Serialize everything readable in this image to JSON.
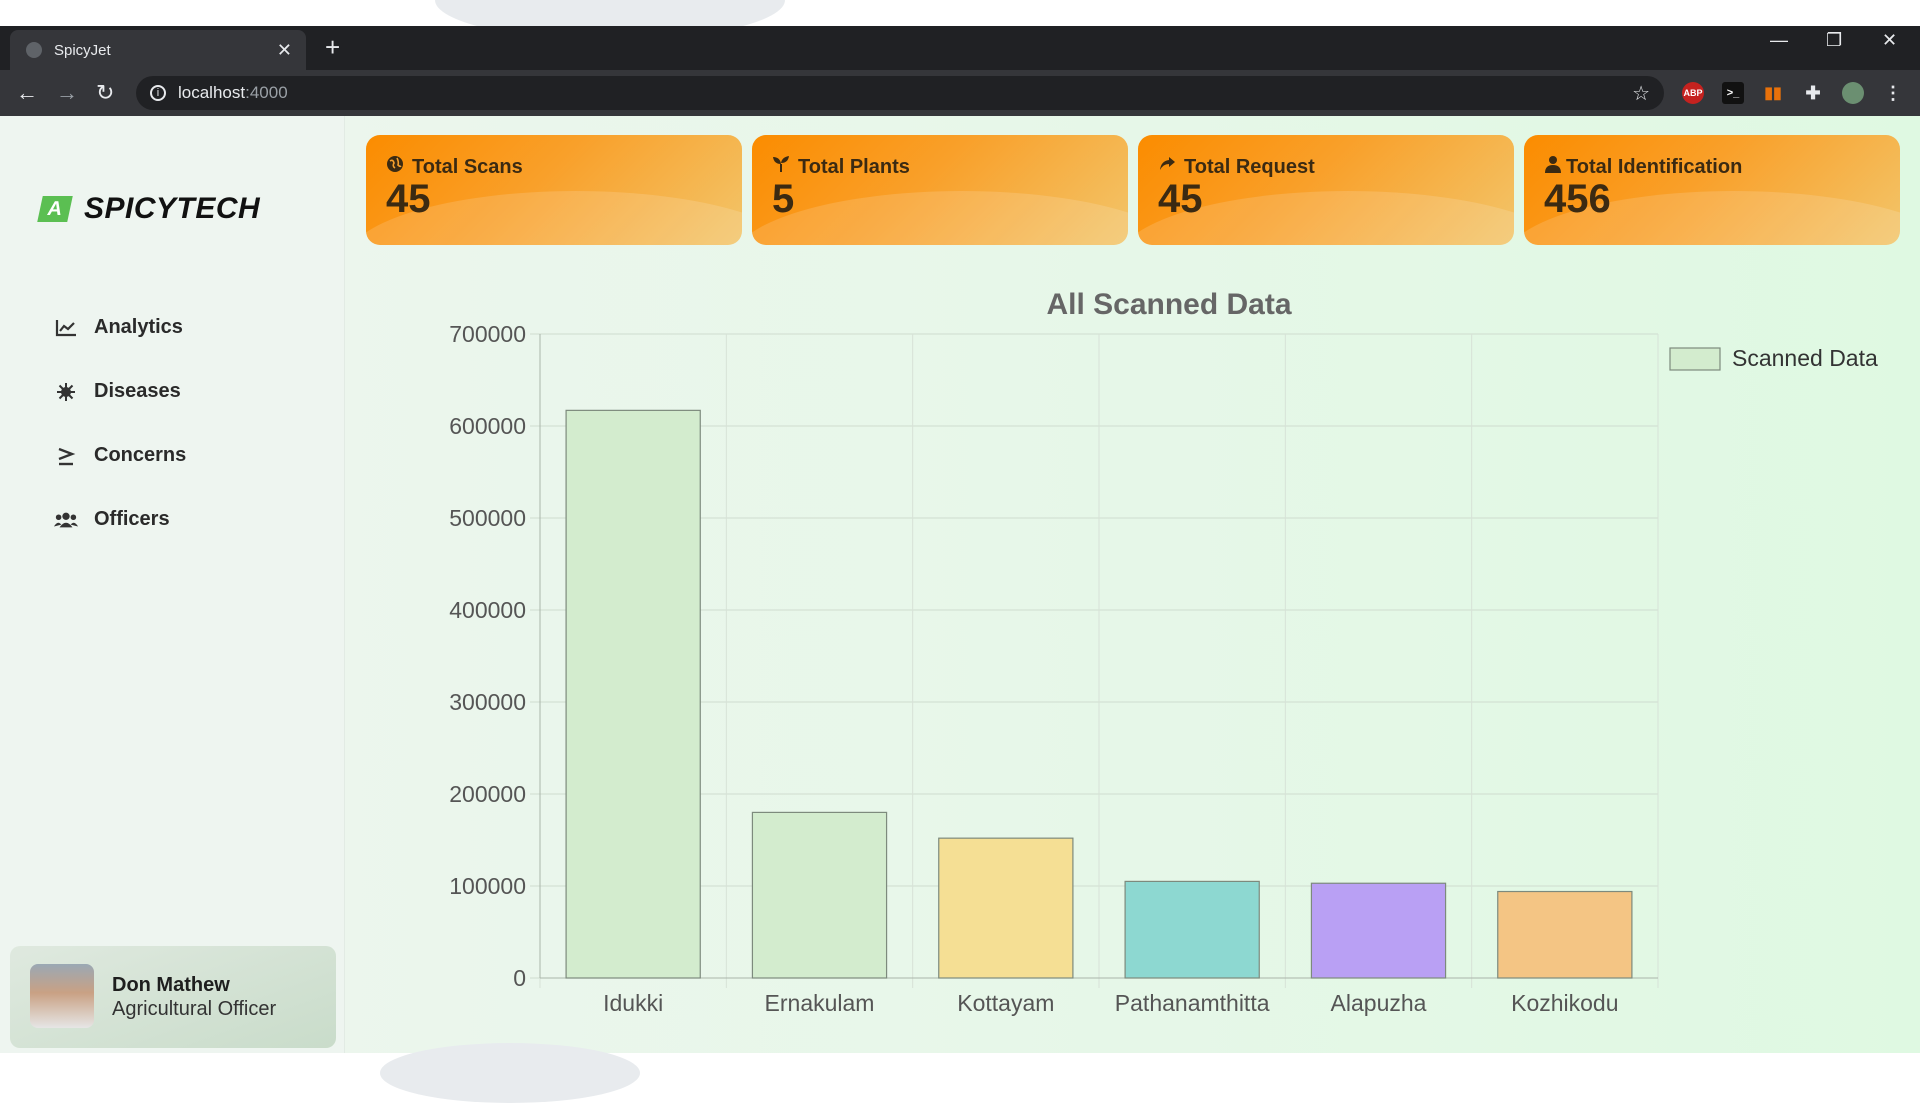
{
  "browser": {
    "tab_title": "SpicyJet",
    "url_host": "localhost",
    "url_port": ":4000"
  },
  "brand": {
    "logo_text": "SPICYTECH",
    "logo_mark": "A"
  },
  "sidebar": {
    "items": [
      {
        "label": "Analytics",
        "icon": "chart-line-icon"
      },
      {
        "label": "Diseases",
        "icon": "virus-icon"
      },
      {
        "label": "Concerns",
        "icon": "greater-equal-icon"
      },
      {
        "label": "Officers",
        "icon": "users-icon"
      }
    ]
  },
  "profile": {
    "name": "Don Mathew",
    "role": "Agricultural Officer"
  },
  "stats": [
    {
      "label": "Total Scans",
      "value": "45",
      "icon": "globe-icon"
    },
    {
      "label": "Total Plants",
      "value": "5",
      "icon": "seedling-icon"
    },
    {
      "label": "Total Request",
      "value": "45",
      "icon": "share-icon"
    },
    {
      "label": "Total Identification",
      "value": "456",
      "icon": "user-icon"
    }
  ],
  "chart_data": {
    "type": "bar",
    "title": "All Scanned Data",
    "categories": [
      "Idukki",
      "Ernakulam",
      "Kottayam",
      "Pathanamthitta",
      "Alapuzha",
      "Kozhikodu"
    ],
    "series": [
      {
        "name": "Scanned Data",
        "values": [
          617000,
          180000,
          152000,
          105000,
          103000,
          94000
        ]
      }
    ],
    "bar_colors": [
      "#d3ecce",
      "#d3ecce",
      "#f5df94",
      "#8dd8d1",
      "#b9a0f4",
      "#f4c584"
    ],
    "ylim": [
      0,
      700000
    ],
    "yticks": [
      0,
      100000,
      200000,
      300000,
      400000,
      500000,
      600000,
      700000
    ],
    "grid": true,
    "legend_position": "top-right",
    "legend_color": "#d3ecce"
  },
  "colors": {
    "accent": "#fb8c00",
    "brand_green": "#5bbf52"
  }
}
